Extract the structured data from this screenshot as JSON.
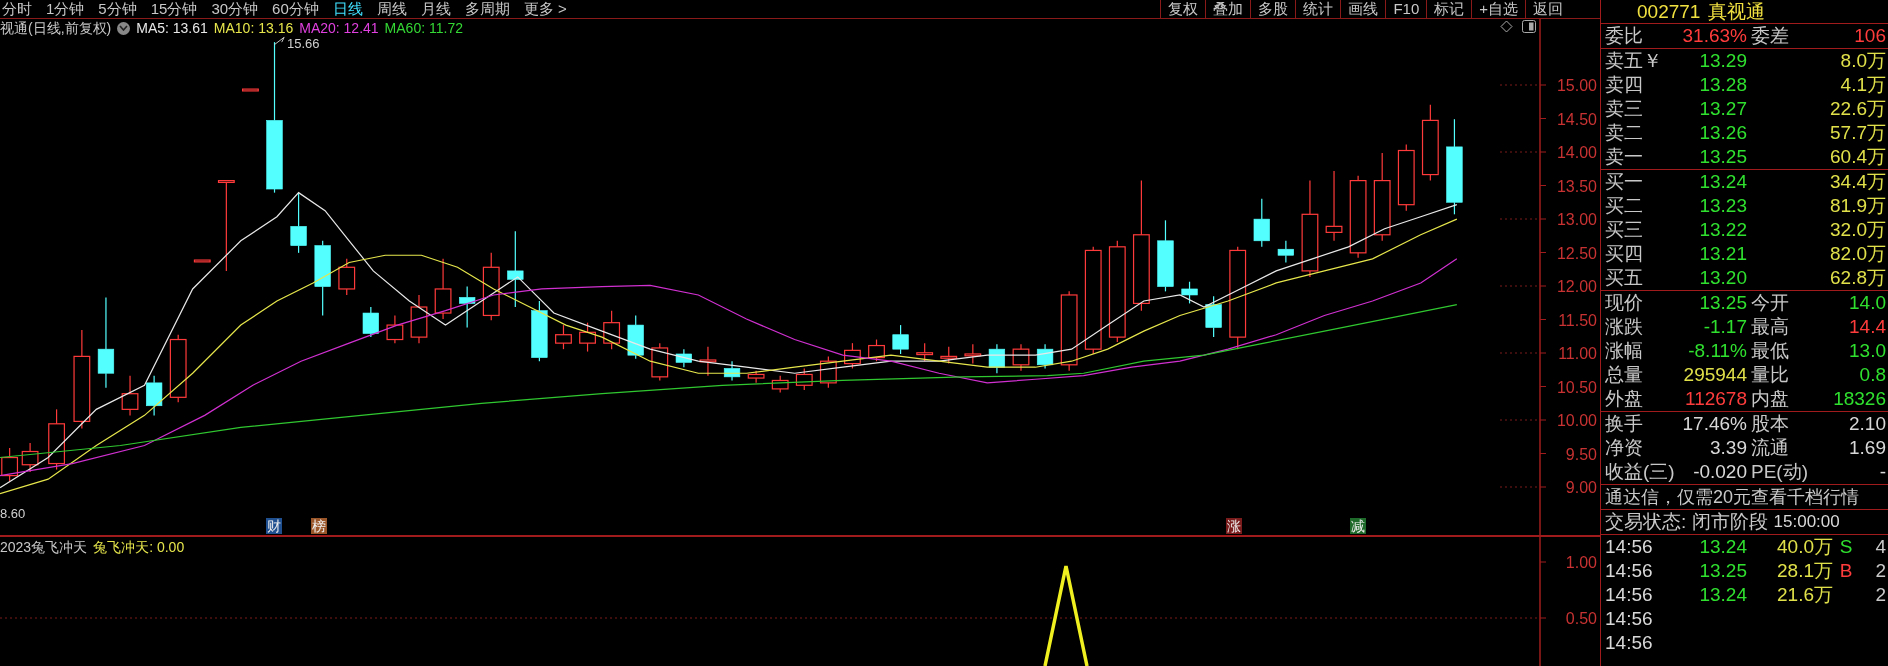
{
  "toolbar": {
    "periods": [
      {
        "label": "分时",
        "selected": false
      },
      {
        "label": "1分钟",
        "selected": false
      },
      {
        "label": "5分钟",
        "selected": false
      },
      {
        "label": "15分钟",
        "selected": false
      },
      {
        "label": "30分钟",
        "selected": false
      },
      {
        "label": "60分钟",
        "selected": false
      },
      {
        "label": "日线",
        "selected": true
      },
      {
        "label": "周线",
        "selected": false
      },
      {
        "label": "月线",
        "selected": false
      },
      {
        "label": "多周期",
        "selected": false
      },
      {
        "label": "更多 >",
        "selected": false
      }
    ],
    "buttons": [
      "复权",
      "叠加",
      "多股",
      "统计",
      "画线",
      "F10",
      "标记",
      "+自选",
      "返回"
    ]
  },
  "stock_header": {
    "code": "002771",
    "name": "真视通"
  },
  "chart_legend": {
    "title": "视通(日线,前复权)",
    "averages": [
      {
        "label": "MA5: 13.61",
        "color": "#e8e8e8"
      },
      {
        "label": "MA10: 13.16",
        "color": "#e6e64c"
      },
      {
        "label": "MA20: 12.41",
        "color": "#e040e0"
      },
      {
        "label": "MA60: 11.72",
        "color": "#34d834"
      }
    ]
  },
  "price_axis": [
    "15.00",
    "14.50",
    "14.00",
    "13.50",
    "13.00",
    "12.50",
    "12.00",
    "11.50",
    "11.00",
    "10.50",
    "10.00",
    "9.50",
    "9.00"
  ],
  "chart_labels": {
    "high": "15.66",
    "low": "8.60"
  },
  "event_markers": [
    {
      "label": "财",
      "color": "#1f4f8f"
    },
    {
      "label": "榜",
      "color": "#9a5628"
    },
    {
      "label": "涨",
      "color": "#7a1c1c"
    },
    {
      "label": "减",
      "color": "#1e6a2a"
    }
  ],
  "indicator": {
    "title": "2023兔飞冲天",
    "value": "兔飞冲天: 0.00",
    "axis": [
      "1.00",
      "0.50"
    ]
  },
  "quote_panel": {
    "ratio_row": {
      "left": {
        "label": "委比",
        "value": "31.63%"
      },
      "right": {
        "label": "委差",
        "value": "106"
      }
    },
    "asks": [
      {
        "label": "卖五￥",
        "price": "13.29",
        "volume": "8.0万"
      },
      {
        "label": "卖四",
        "price": "13.28",
        "volume": "4.1万"
      },
      {
        "label": "卖三",
        "price": "13.27",
        "volume": "22.6万"
      },
      {
        "label": "卖二",
        "price": "13.26",
        "volume": "57.7万"
      },
      {
        "label": "卖一",
        "price": "13.25",
        "volume": "60.4万"
      }
    ],
    "bids": [
      {
        "label": "买一",
        "price": "13.24",
        "volume": "34.4万"
      },
      {
        "label": "买二",
        "price": "13.23",
        "volume": "81.9万"
      },
      {
        "label": "买三",
        "price": "13.22",
        "volume": "32.0万"
      },
      {
        "label": "买四",
        "price": "13.21",
        "volume": "82.0万"
      },
      {
        "label": "买五",
        "price": "13.20",
        "volume": "62.8万"
      }
    ],
    "quote_stats": [
      {
        "left": {
          "label": "现价",
          "value": "13.25",
          "color": "#2fe02f"
        },
        "right": {
          "label": "今开",
          "value": "14.0",
          "color": "#2fe02f"
        }
      },
      {
        "left": {
          "label": "涨跌",
          "value": "-1.17",
          "color": "#2fe02f"
        },
        "right": {
          "label": "最高",
          "value": "14.4",
          "color": "#ff3c3c"
        }
      },
      {
        "left": {
          "label": "涨幅",
          "value": "-8.11%",
          "color": "#2fe02f"
        },
        "right": {
          "label": "最低",
          "value": "13.0",
          "color": "#2fe02f"
        }
      },
      {
        "left": {
          "label": "总量",
          "value": "295944",
          "color": "#e0e04a"
        },
        "right": {
          "label": "量比",
          "value": "0.8",
          "color": "#2fe02f"
        }
      },
      {
        "left": {
          "label": "外盘",
          "value": "112678",
          "color": "#ff3c3c"
        },
        "right": {
          "label": "内盘",
          "value": "18326",
          "color": "#2fe02f"
        }
      }
    ],
    "share_stats": [
      {
        "left": {
          "label": "换手",
          "value": "17.46%"
        },
        "right": {
          "label": "股本",
          "value": "2.10"
        }
      },
      {
        "left": {
          "label": "净资",
          "value": "3.39"
        },
        "right": {
          "label": "流通",
          "value": "1.69"
        }
      },
      {
        "left": {
          "label": "收益(三)",
          "value": "-0.020"
        },
        "right": {
          "label": "PE(动)",
          "value": "-"
        }
      }
    ],
    "notice": "通达信，仅需20元查看千档行情",
    "trade_status": {
      "label": "交易状态: 闭市阶段",
      "time": "15:00:00"
    },
    "trades": [
      {
        "time": "14:56",
        "price": "13.24",
        "volume": "40.0万",
        "side": "S",
        "count": "4"
      },
      {
        "time": "14:56",
        "price": "13.25",
        "volume": "28.1万",
        "side": "B",
        "count": "2"
      },
      {
        "time": "14:56",
        "price": "13.24",
        "volume": "21.6万",
        "count": "2"
      },
      {
        "time": "14:56"
      },
      {
        "time": "14:56"
      }
    ]
  }
}
